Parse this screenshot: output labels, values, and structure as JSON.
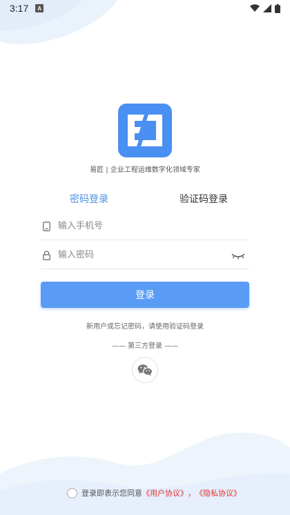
{
  "status_bar": {
    "time": "3:17",
    "notification_letter": "A"
  },
  "app": {
    "tagline": "易匠 | 企业工程运维数字化领域专家"
  },
  "tabs": {
    "password_login": "密码登录",
    "code_login": "验证码登录",
    "active": "password_login"
  },
  "form": {
    "phone_placeholder": "输入手机号",
    "password_placeholder": "输入密码",
    "login_button": "登录"
  },
  "hint": "新用户或忘记密码，请使用验证码登录",
  "third_party": {
    "label": "—— 第三方登录 ——",
    "wechat_icon": "wechat-icon"
  },
  "agreement": {
    "prefix": "登录即表示您同意",
    "user_agreement": "《用户协议》",
    "separator": "，",
    "privacy_policy": "《隐私协议》"
  },
  "colors": {
    "accent": "#4a90e2",
    "logo": "#4a8ff2",
    "button": "#5a9cf5",
    "link": "#e0312f"
  }
}
